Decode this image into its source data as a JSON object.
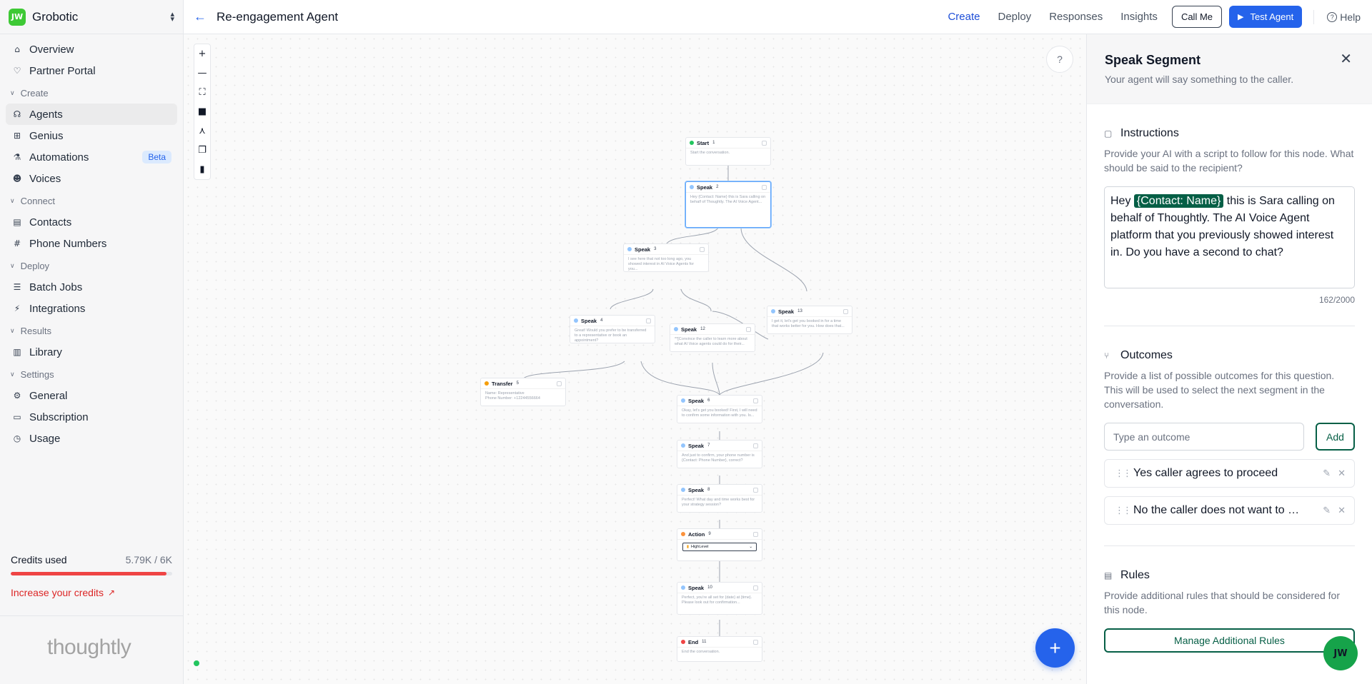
{
  "workspace": {
    "logo": "JW",
    "name": "Grobotic"
  },
  "sidebar": {
    "top": [
      {
        "label": "Overview",
        "icon": "home-icon"
      },
      {
        "label": "Partner Portal",
        "icon": "heart-icon"
      }
    ],
    "sections": [
      {
        "title": "Create",
        "items": [
          {
            "label": "Agents",
            "icon": "headset-icon",
            "active": true
          },
          {
            "label": "Genius",
            "icon": "grid-icon"
          },
          {
            "label": "Automations",
            "icon": "flask-icon",
            "badge": "Beta"
          },
          {
            "label": "Voices",
            "icon": "users-icon"
          }
        ]
      },
      {
        "title": "Connect",
        "items": [
          {
            "label": "Contacts",
            "icon": "contacts-icon"
          },
          {
            "label": "Phone Numbers",
            "icon": "hash-icon"
          }
        ]
      },
      {
        "title": "Deploy",
        "items": [
          {
            "label": "Batch Jobs",
            "icon": "list-icon"
          },
          {
            "label": "Integrations",
            "icon": "plug-icon"
          }
        ]
      },
      {
        "title": "Results",
        "items": [
          {
            "label": "Library",
            "icon": "book-icon"
          }
        ]
      },
      {
        "title": "Settings",
        "items": [
          {
            "label": "General",
            "icon": "gear-icon"
          },
          {
            "label": "Subscription",
            "icon": "card-icon"
          },
          {
            "label": "Usage",
            "icon": "clock-icon"
          }
        ]
      }
    ],
    "credits": {
      "label": "Credits used",
      "value": "5.79K / 6K",
      "fraction": 0.965
    },
    "increase": "Increase your credits",
    "brand": "thoughtly"
  },
  "topbar": {
    "title": "Re-engagement Agent",
    "tabs": [
      {
        "label": "Create",
        "active": true
      },
      {
        "label": "Deploy"
      },
      {
        "label": "Responses"
      },
      {
        "label": "Insights"
      }
    ],
    "call_me": "Call Me",
    "test_agent": "Test Agent",
    "help": "Help"
  },
  "canvas": {
    "nodes": [
      {
        "type": "Start",
        "num": "1",
        "dot": "green",
        "body": "Start the conversation."
      },
      {
        "type": "Speak",
        "num": "2",
        "dot": "blue",
        "body": "Hey {Contact: Name} this is Sara calling on behalf of Thoughtly. The AI Voice Agent...",
        "selected": true
      },
      {
        "type": "Speak",
        "num": "3",
        "dot": "blue",
        "body": "I see here that not too long ago, you showed interest in AI Voice Agents for you..."
      },
      {
        "type": "Speak",
        "num": "4",
        "dot": "blue",
        "body": "Great! Would you prefer to be transferred to a representative or book an appointment?"
      },
      {
        "type": "Speak",
        "num": "12",
        "dot": "blue",
        "body": "**[Convince the caller to learn more about what AI Voice agents could do for their..."
      },
      {
        "type": "Speak",
        "num": "13",
        "dot": "blue",
        "body": "I get it, let's get you booked in for a time that works better for you. How does that..."
      },
      {
        "type": "Transfer",
        "num": "5",
        "dot": "amber",
        "body": "Name: Representative\nPhone Number: +12244556664"
      },
      {
        "type": "Speak",
        "num": "6",
        "dot": "blue",
        "body": "Okay, let's get you booked! First, I will need to confirm some information with you. Is..."
      },
      {
        "type": "Speak",
        "num": "7",
        "dot": "blue",
        "body": "And just to confirm, your phone number is {Contact: Phone Number}, correct?"
      },
      {
        "type": "Speak",
        "num": "8",
        "dot": "blue",
        "body": "Perfect! What day and time works best for your strategy session?"
      },
      {
        "type": "Action",
        "num": "9",
        "dot": "orange",
        "select": "HighLevel"
      },
      {
        "type": "Speak",
        "num": "10",
        "dot": "blue",
        "body": "Perfect, you're all set for {date} at {time}. Please look out for confirmation..."
      },
      {
        "type": "End",
        "num": "11",
        "dot": "red",
        "body": "End the conversation."
      }
    ]
  },
  "panel": {
    "title": "Speak Segment",
    "subtitle": "Your agent will say something to the caller.",
    "instructions": {
      "title": "Instructions",
      "desc": "Provide your AI with a script to follow for this node. What should be said to the recipient?",
      "script_pre": "Hey ",
      "script_chip": "{Contact: Name}",
      "script_post": " this is Sara calling on behalf of Thoughtly. The AI Voice Agent platform that you previously showed interest in. Do you have a second to chat?",
      "count": "162/2000"
    },
    "outcomes": {
      "title": "Outcomes",
      "desc": "Provide a list of possible outcomes for this question. This will be used to select the next segment in the conversation.",
      "placeholder": "Type an outcome",
      "add": "Add",
      "items": [
        "Yes caller agrees to proceed",
        "No the caller does not want to proceed"
      ]
    },
    "rules": {
      "title": "Rules",
      "desc": "Provide additional rules that should be considered for this node.",
      "button": "Manage Additional Rules"
    }
  },
  "colors": {
    "accent": "#2563eb",
    "brand_green": "#065f46",
    "logo_green": "#3ec935",
    "danger": "#ef4444"
  }
}
